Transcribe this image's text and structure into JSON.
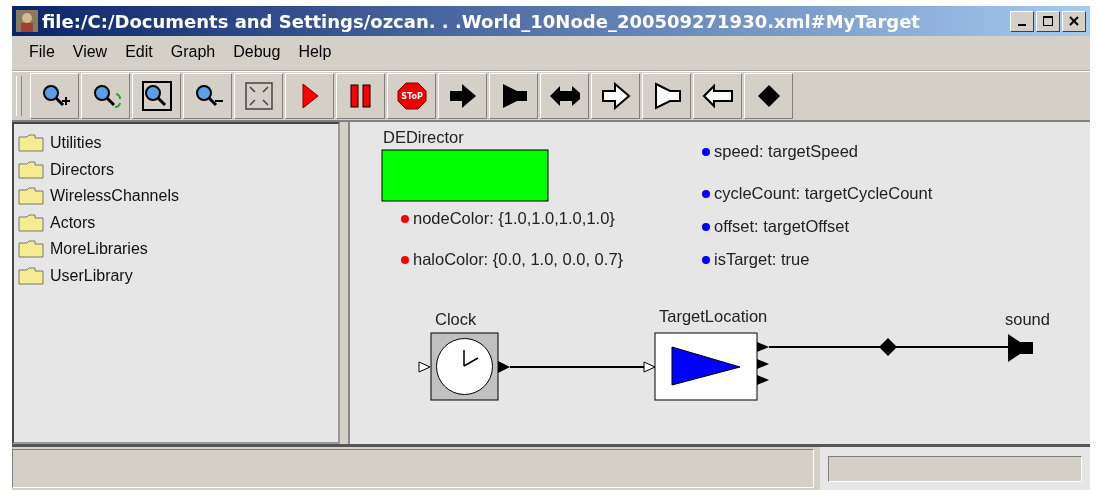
{
  "window": {
    "title": "file:/C:/Documents and Settings/ozcan. . .World_10Node_200509271930.xml#MyTarget"
  },
  "menu": [
    "File",
    "View",
    "Edit",
    "Graph",
    "Debug",
    "Help"
  ],
  "toolbar": [
    {
      "kind": "zoom-in"
    },
    {
      "kind": "zoom-reset"
    },
    {
      "kind": "zoom-fit"
    },
    {
      "kind": "zoom-out"
    },
    {
      "kind": "full-screen"
    },
    {
      "kind": "run"
    },
    {
      "kind": "pause"
    },
    {
      "kind": "stop",
      "text": "SToP"
    },
    {
      "kind": "output-port"
    },
    {
      "kind": "output-flag"
    },
    {
      "kind": "inout-port"
    },
    {
      "kind": "input-port"
    },
    {
      "kind": "input-flag"
    },
    {
      "kind": "inout-open-port"
    },
    {
      "kind": "relation"
    }
  ],
  "library": [
    {
      "label": "Utilities"
    },
    {
      "label": "Directors"
    },
    {
      "label": "WirelessChannels"
    },
    {
      "label": "Actors"
    },
    {
      "label": "MoreLibraries"
    },
    {
      "label": "UserLibrary"
    }
  ],
  "canvas": {
    "director": {
      "label": "DEDirector"
    },
    "parameters": [
      {
        "text": "nodeColor: {1.0,1.0,1.0,1.0}",
        "color": "#ff0000"
      },
      {
        "text": "haloColor: {0.0, 1.0, 0.0, 0.7}",
        "color": "#ff0000"
      },
      {
        "text": "speed: targetSpeed",
        "color": "#0000ff"
      },
      {
        "text": "cycleCount: targetCycleCount",
        "color": "#0000ff"
      },
      {
        "text": "offset: targetOffset",
        "color": "#0000ff"
      },
      {
        "text": "isTarget: true",
        "color": "#0000ff"
      }
    ],
    "actors": [
      {
        "label": "Clock",
        "kind": "clock"
      },
      {
        "label": "TargetLocation",
        "kind": "target"
      },
      {
        "label": "sound",
        "kind": "port"
      }
    ]
  }
}
